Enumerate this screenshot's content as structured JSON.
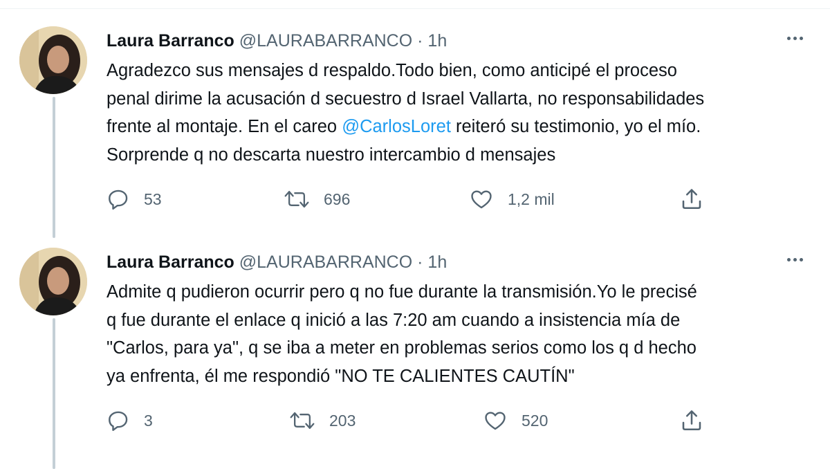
{
  "tweets": [
    {
      "name": "Laura Barranco",
      "handle": "@LAURABARRANCO",
      "separator": "·",
      "time": "1h",
      "lines": [
        "Agradezco sus mensajes d respaldo.Todo bien, como anticipé el proceso",
        "penal dirime la acusación d secuestro d Israel Vallarta, no responsabilidades",
        "frente al montaje. En el careo ",
        "Sorprende q no descarta nuestro intercambio d mensajes"
      ],
      "mention": "@CarlosLoret",
      "line3_after_mention": " reiteró su testimonio, yo el mío.",
      "replies": "53",
      "retweets": "696",
      "likes": "1,2 mil"
    },
    {
      "name": "Laura Barranco",
      "handle": "@LAURABARRANCO",
      "separator": "·",
      "time": "1h",
      "lines": [
        "Admite q pudieron ocurrir pero q no fue durante la transmisión.Yo le precisé",
        "q fue durante el enlace q inició a las 7:20 am cuando a insistencia mía de",
        "\"Carlos, para ya\", q se iba a meter en problemas serios como los q d hecho",
        "ya enfrenta, él me respondió \"NO TE CALIENTES CAUTÍN\""
      ],
      "replies": "3",
      "retweets": "203",
      "likes": "520"
    }
  ],
  "icons": {
    "reply": "reply-icon",
    "retweet": "retweet-icon",
    "like": "heart-icon",
    "share": "share-icon",
    "more": "more-icon"
  },
  "colors": {
    "mention": "#1d9bf0",
    "secondary": "#536471",
    "thread_line": "#c4cfd6"
  }
}
